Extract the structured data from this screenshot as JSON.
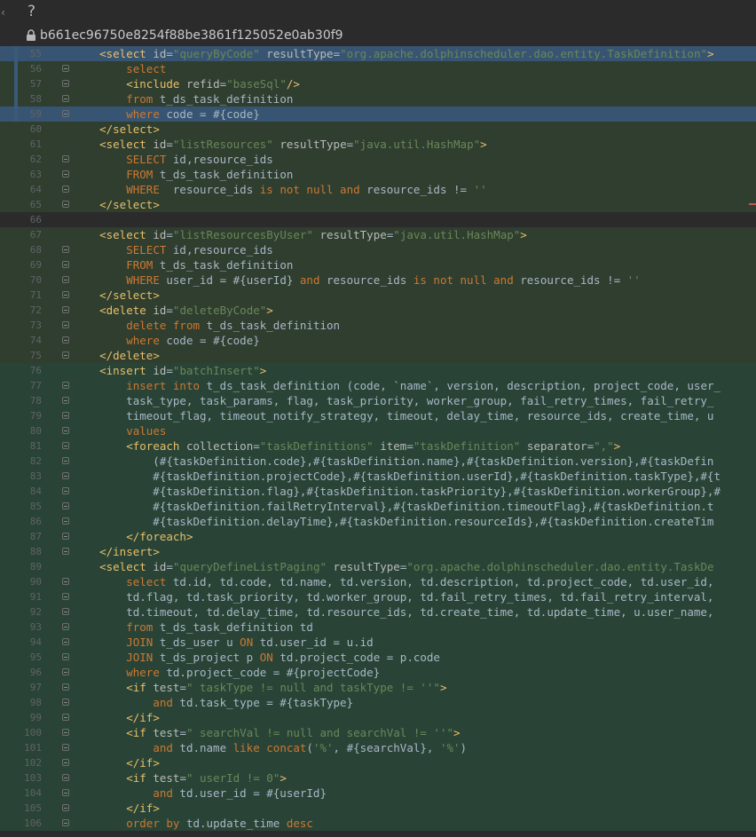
{
  "toolbar": {
    "help_symbol": "?"
  },
  "commit": {
    "hash": "b661ec96750e8254f88be3861f125052e0ab30f9"
  },
  "lines": [
    {
      "n": "55",
      "bg": "bg-blue-strong",
      "html": "    <span class='xml-tag'>&lt;select</span> <span class='attr-name'>id</span>=<span class='attr-val'>\"queryByCode\"</span> <span class='attr-name'>resultType</span>=<span class='attr-val'>\"org.apache.dolphinscheduler.dao.entity.TaskDefinition\"</span><span class='xml-tag'>&gt;</span>"
    },
    {
      "n": "56",
      "bg": "bg-green",
      "fold": true,
      "html": "        <span class='sql-kw'>select</span>"
    },
    {
      "n": "57",
      "bg": "bg-green",
      "fold": true,
      "html": "        <span class='xml-tag'>&lt;include</span> <span class='attr-name'>refid</span>=<span class='attr-val'>\"baseSql\"</span><span class='xml-tag'>/&gt;</span>"
    },
    {
      "n": "58",
      "bg": "bg-green",
      "fold": true,
      "html": "        <span class='sql-kw'>from</span> t_ds_task_definition"
    },
    {
      "n": "59",
      "bg": "bg-blue-strong",
      "fold": true,
      "html": "        <span class='sql-kw'>where</span> code = #{code}"
    },
    {
      "n": "60",
      "bg": "bg-green",
      "html": "    <span class='xml-tag'>&lt;/select&gt;</span>"
    },
    {
      "n": "61",
      "bg": "bg-green",
      "html": "    <span class='xml-tag'>&lt;select</span> <span class='attr-name'>id</span>=<span class='attr-val'>\"listResources\"</span> <span class='attr-name'>resultType</span>=<span class='attr-val'>\"java.util.HashMap\"</span><span class='xml-tag'>&gt;</span>"
    },
    {
      "n": "62",
      "bg": "bg-green",
      "fold": true,
      "html": "        <span class='sql-kw'>SELECT</span> id,resource_ids"
    },
    {
      "n": "63",
      "bg": "bg-green",
      "fold": true,
      "html": "        <span class='sql-kw'>FROM</span> t_ds_task_definition"
    },
    {
      "n": "64",
      "bg": "bg-green",
      "fold": true,
      "html": "        <span class='sql-kw'>WHERE</span>  resource_ids <span class='sql-kw'>is not null and</span> resource_ids != <span class='attr-val'>''</span>"
    },
    {
      "n": "65",
      "bg": "bg-green",
      "fold": true,
      "marker": true,
      "html": "    <span class='xml-tag'>&lt;/select&gt;</span>"
    },
    {
      "n": "66",
      "bg": "bg-plain",
      "html": ""
    },
    {
      "n": "67",
      "bg": "bg-green",
      "html": "    <span class='xml-tag'>&lt;select</span> <span class='attr-name'>id</span>=<span class='attr-val'>\"listResourcesByUser\"</span> <span class='attr-name'>resultType</span>=<span class='attr-val'>\"java.util.HashMap\"</span><span class='xml-tag'>&gt;</span>"
    },
    {
      "n": "68",
      "bg": "bg-green",
      "fold": true,
      "html": "        <span class='sql-kw'>SELECT</span> id,resource_ids"
    },
    {
      "n": "69",
      "bg": "bg-green",
      "fold": true,
      "html": "        <span class='sql-kw'>FROM</span> t_ds_task_definition"
    },
    {
      "n": "70",
      "bg": "bg-green",
      "fold": true,
      "html": "        <span class='sql-kw'>WHERE</span> user_id = #{userId} <span class='sql-kw'>and</span> resource_ids <span class='sql-kw'>is not null and</span> resource_ids != <span class='attr-val'>''</span>"
    },
    {
      "n": "71",
      "bg": "bg-green",
      "fold": true,
      "html": "    <span class='xml-tag'>&lt;/select&gt;</span>"
    },
    {
      "n": "72",
      "bg": "bg-green",
      "fold": true,
      "html": "    <span class='xml-tag'>&lt;delete</span> <span class='attr-name'>id</span>=<span class='attr-val'>\"deleteByCode\"</span><span class='xml-tag'>&gt;</span>"
    },
    {
      "n": "73",
      "bg": "bg-green",
      "fold": true,
      "html": "        <span class='sql-kw'>delete from</span> t_ds_task_definition"
    },
    {
      "n": "74",
      "bg": "bg-green",
      "fold": true,
      "html": "        <span class='sql-kw'>where</span> code = #{code}"
    },
    {
      "n": "75",
      "bg": "bg-green",
      "fold": true,
      "html": "    <span class='xml-tag'>&lt;/delete&gt;</span>"
    },
    {
      "n": "76",
      "bg": "bg-green2",
      "html": "    <span class='xml-tag'>&lt;insert</span> <span class='attr-name'>id</span>=<span class='attr-val'>\"batchInsert\"</span><span class='xml-tag'>&gt;</span>"
    },
    {
      "n": "77",
      "bg": "bg-green2",
      "fold": true,
      "html": "        <span class='sql-kw'>insert into</span> t_ds_task_definition (code, `name`, version, description, project_code, user_"
    },
    {
      "n": "78",
      "bg": "bg-green2",
      "fold": true,
      "html": "        task_type, task_params, flag, task_priority, worker_group, fail_retry_times, fail_retry_"
    },
    {
      "n": "79",
      "bg": "bg-green2",
      "fold": true,
      "html": "        timeout_flag, timeout_notify_strategy, timeout, delay_time, resource_ids, create_time, u"
    },
    {
      "n": "80",
      "bg": "bg-green2",
      "fold": true,
      "html": "        <span class='sql-kw'>values</span>"
    },
    {
      "n": "81",
      "bg": "bg-green2",
      "fold": true,
      "html": "        <span class='xml-tag'>&lt;foreach</span> <span class='attr-name'>collection</span>=<span class='attr-val'>\"taskDefinitions\"</span> <span class='attr-name'>item</span>=<span class='attr-val'>\"taskDefinition\"</span> <span class='attr-name'>separator</span>=<span class='attr-val'>\",\"</span><span class='xml-tag'>&gt;</span>"
    },
    {
      "n": "82",
      "bg": "bg-green2",
      "fold": true,
      "html": "            (#{taskDefinition.code},#{taskDefinition.name},#{taskDefinition.version},#{taskDefin"
    },
    {
      "n": "83",
      "bg": "bg-green2",
      "fold": true,
      "html": "            #{taskDefinition.projectCode},#{taskDefinition.userId},#{taskDefinition.taskType},#{t"
    },
    {
      "n": "84",
      "bg": "bg-green2",
      "fold": true,
      "html": "            #{taskDefinition.flag},#{taskDefinition.taskPriority},#{taskDefinition.workerGroup},#"
    },
    {
      "n": "85",
      "bg": "bg-green2",
      "fold": true,
      "html": "            #{taskDefinition.failRetryInterval},#{taskDefinition.timeoutFlag},#{taskDefinition.t"
    },
    {
      "n": "86",
      "bg": "bg-green2",
      "fold": true,
      "html": "            #{taskDefinition.delayTime},#{taskDefinition.resourceIds},#{taskDefinition.createTim"
    },
    {
      "n": "87",
      "bg": "bg-green2",
      "fold": true,
      "html": "        <span class='xml-tag'>&lt;/foreach&gt;</span>"
    },
    {
      "n": "88",
      "bg": "bg-green2",
      "fold": true,
      "html": "    <span class='xml-tag'>&lt;/insert&gt;</span>"
    },
    {
      "n": "89",
      "bg": "bg-green2",
      "html": "    <span class='xml-tag'>&lt;select</span> <span class='attr-name'>id</span>=<span class='attr-val'>\"queryDefineListPaging\"</span> <span class='attr-name'>resultType</span>=<span class='attr-val'>\"org.apache.dolphinscheduler.dao.entity.TaskDe</span>"
    },
    {
      "n": "90",
      "bg": "bg-green2",
      "fold": true,
      "html": "        <span class='sql-kw'>select</span> td.id, td.code, td.name, td.version, td.description, td.project_code, td.user_id,"
    },
    {
      "n": "91",
      "bg": "bg-green2",
      "fold": true,
      "html": "        td.flag, td.task_priority, td.worker_group, td.fail_retry_times, td.fail_retry_interval,"
    },
    {
      "n": "92",
      "bg": "bg-green2",
      "fold": true,
      "html": "        td.timeout, td.delay_time, td.resource_ids, td.create_time, td.update_time, u.user_name,"
    },
    {
      "n": "93",
      "bg": "bg-green2",
      "fold": true,
      "html": "        <span class='sql-kw'>from</span> t_ds_task_definition td"
    },
    {
      "n": "94",
      "bg": "bg-green2",
      "fold": true,
      "html": "        <span class='sql-kw'>JOIN</span> t_ds_user u <span class='sql-kw'>ON</span> td.user_id = u.id"
    },
    {
      "n": "95",
      "bg": "bg-green2",
      "fold": true,
      "html": "        <span class='sql-kw'>JOIN</span> t_ds_project p <span class='sql-kw'>ON</span> td.project_code = p.code"
    },
    {
      "n": "96",
      "bg": "bg-green2",
      "fold": true,
      "html": "        <span class='sql-kw'>where</span> td.project_code = #{projectCode}"
    },
    {
      "n": "97",
      "bg": "bg-green2",
      "fold": true,
      "html": "        <span class='xml-tag'>&lt;if</span> <span class='attr-name'>test</span>=<span class='attr-val'>\" taskType != null and taskType != ''\"</span><span class='xml-tag'>&gt;</span>"
    },
    {
      "n": "98",
      "bg": "bg-green2",
      "fold": true,
      "html": "            <span class='sql-kw'>and</span> td.task_type = #{taskType}"
    },
    {
      "n": "99",
      "bg": "bg-green2",
      "fold": true,
      "html": "        <span class='xml-tag'>&lt;/if&gt;</span>"
    },
    {
      "n": "100",
      "bg": "bg-green2",
      "fold": true,
      "html": "        <span class='xml-tag'>&lt;if</span> <span class='attr-name'>test</span>=<span class='attr-val'>\" searchVal != null and searchVal != ''\"</span><span class='xml-tag'>&gt;</span>"
    },
    {
      "n": "101",
      "bg": "bg-green2",
      "fold": true,
      "html": "            <span class='sql-kw'>and</span> td.name <span class='sql-kw'>like</span> <span class='sql-kw'>concat</span>(<span class='attr-val'>'%'</span>, #{searchVal}, <span class='attr-val'>'%'</span>)"
    },
    {
      "n": "102",
      "bg": "bg-green2",
      "fold": true,
      "html": "        <span class='xml-tag'>&lt;/if&gt;</span>"
    },
    {
      "n": "103",
      "bg": "bg-green2",
      "fold": true,
      "html": "        <span class='xml-tag'>&lt;if</span> <span class='attr-name'>test</span>=<span class='attr-val'>\" userId != 0\"</span><span class='xml-tag'>&gt;</span>"
    },
    {
      "n": "104",
      "bg": "bg-green2",
      "fold": true,
      "html": "            <span class='sql-kw'>and</span> td.user_id = #{userId}"
    },
    {
      "n": "105",
      "bg": "bg-green2",
      "fold": true,
      "html": "        <span class='xml-tag'>&lt;/if&gt;</span>"
    },
    {
      "n": "106",
      "bg": "bg-green2",
      "fold": true,
      "html": "        <span class='sql-kw'>order by</span> td.update_time <span class='sql-kw'>desc</span>"
    }
  ]
}
